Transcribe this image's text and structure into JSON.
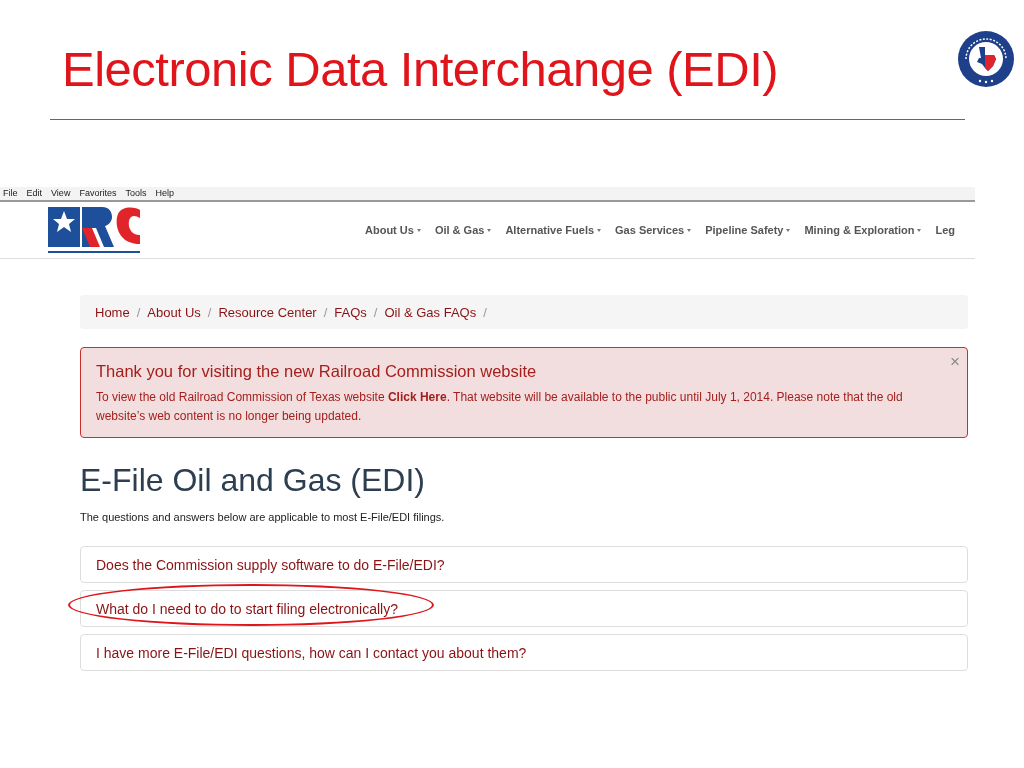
{
  "slide": {
    "title": "Electronic Data Interchange (EDI)"
  },
  "browser": {
    "menu": [
      "File",
      "Edit",
      "View",
      "Favorites",
      "Tools",
      "Help"
    ]
  },
  "site": {
    "nav": [
      {
        "label": "About Us",
        "dropdown": true
      },
      {
        "label": "Oil & Gas",
        "dropdown": true
      },
      {
        "label": "Alternative Fuels",
        "dropdown": true
      },
      {
        "label": "Gas Services",
        "dropdown": true
      },
      {
        "label": "Pipeline Safety",
        "dropdown": true
      },
      {
        "label": "Mining & Exploration",
        "dropdown": true
      },
      {
        "label": "Leg",
        "dropdown": false
      }
    ],
    "breadcrumb": {
      "separator": "/",
      "items": [
        "Home",
        "About Us",
        "Resource Center",
        "FAQs",
        "Oil & Gas FAQs"
      ]
    },
    "alert": {
      "title": "Thank you for visiting the new Railroad Commission website",
      "text": "To view the old Railroad Commission of Texas website **Click Here**. That website will be available to the public until July 1, 2014. Please note that the old website’s web content is no longer being updated.",
      "close": "×"
    },
    "heading": "E-File Oil and Gas (EDI)",
    "intro": "The questions and answers below are applicable to most E-File/EDI filings.",
    "faqs": [
      {
        "question": "Does the Commission supply software to do E-File/EDI?",
        "highlighted": false
      },
      {
        "question": "What do I need to do to start filing electronically?",
        "highlighted": true
      },
      {
        "question": "I have more E-File/EDI questions, how can I contact you about them?",
        "highlighted": false
      }
    ]
  }
}
